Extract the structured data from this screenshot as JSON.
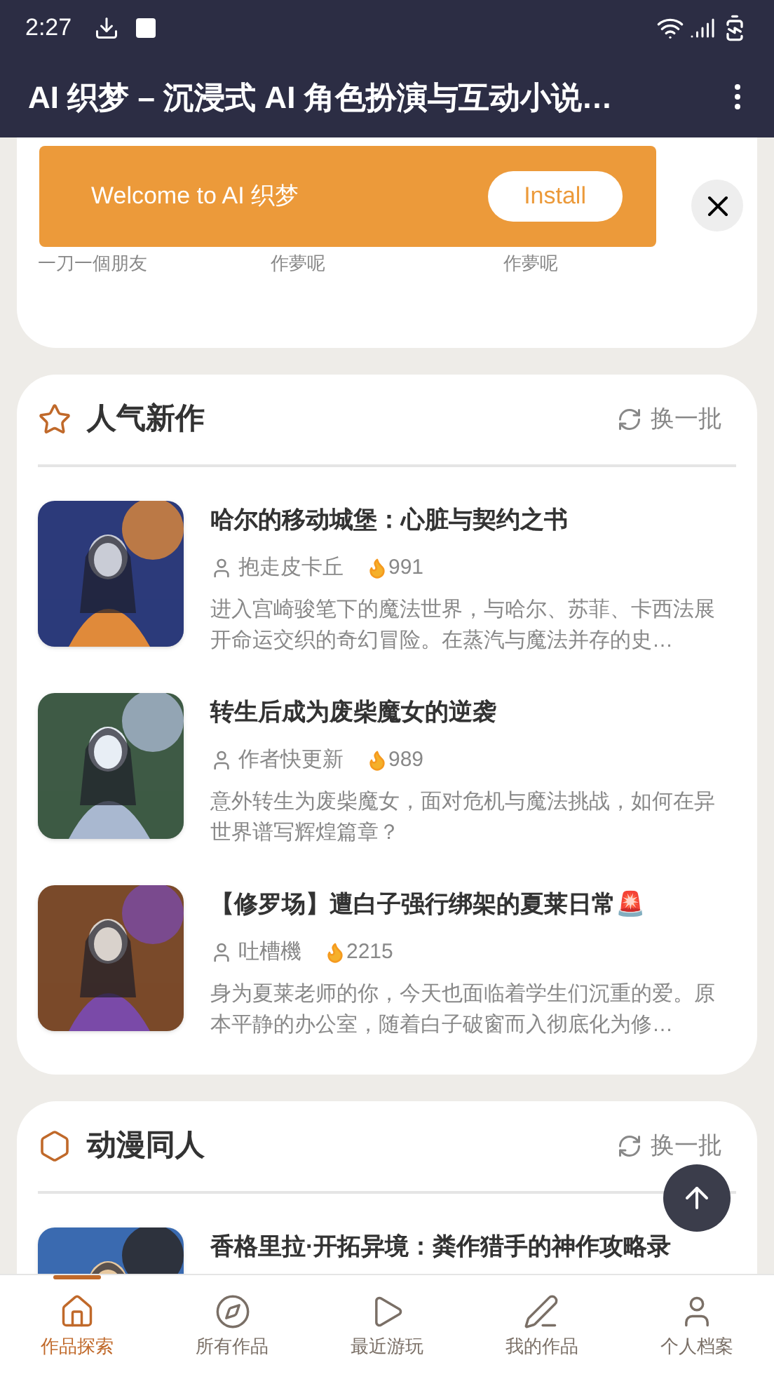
{
  "status_bar": {
    "time": "2:27"
  },
  "app_bar": {
    "title": "AI 织梦 – 沉浸式 AI 角色扮演与互动小说…"
  },
  "install_banner": {
    "message": "Welcome to AI 织梦",
    "button": "Install"
  },
  "top_card": {
    "authors": [
      "一刀一個朋友",
      "作夢呢",
      "作夢呢"
    ]
  },
  "sections": [
    {
      "kind": "star",
      "title": "人气新作",
      "refresh": "换一批",
      "items": [
        {
          "title": "哈尔的移动城堡：心脏与契约之书",
          "author": "抱走皮卡丘",
          "heat": "991",
          "description": "进入宫崎骏笔下的魔法世界，与哈尔、苏菲、卡西法展开命运交织的奇幻冒险。在蒸汽与魔法并存的史…"
        },
        {
          "title": "转生后成为废柴魔女的逆袭",
          "author": "作者快更新",
          "heat": "989",
          "description": "意外转生为废柴魔女，面对危机与魔法挑战，如何在异世界谱写辉煌篇章？"
        },
        {
          "title": "【修罗场】遭白子强行绑架的夏莱日常🚨",
          "author": "吐槽機",
          "heat": "2215",
          "description": "身为夏莱老师的你，今天也面临着学生们沉重的爱。原本平静的办公室，随着白子破窗而入彻底化为修…"
        }
      ]
    },
    {
      "kind": "hexagon",
      "title": "动漫同人",
      "refresh": "换一批",
      "items": [
        {
          "title": "香格里拉·开拓异境：粪作猎手的神作攻略录"
        }
      ]
    }
  ],
  "nav": [
    {
      "label": "作品探索",
      "selected": true
    },
    {
      "label": "所有作品",
      "selected": false
    },
    {
      "label": "最近游玩",
      "selected": false
    },
    {
      "label": "我的作品",
      "selected": false
    },
    {
      "label": "个人档案",
      "selected": false
    }
  ]
}
